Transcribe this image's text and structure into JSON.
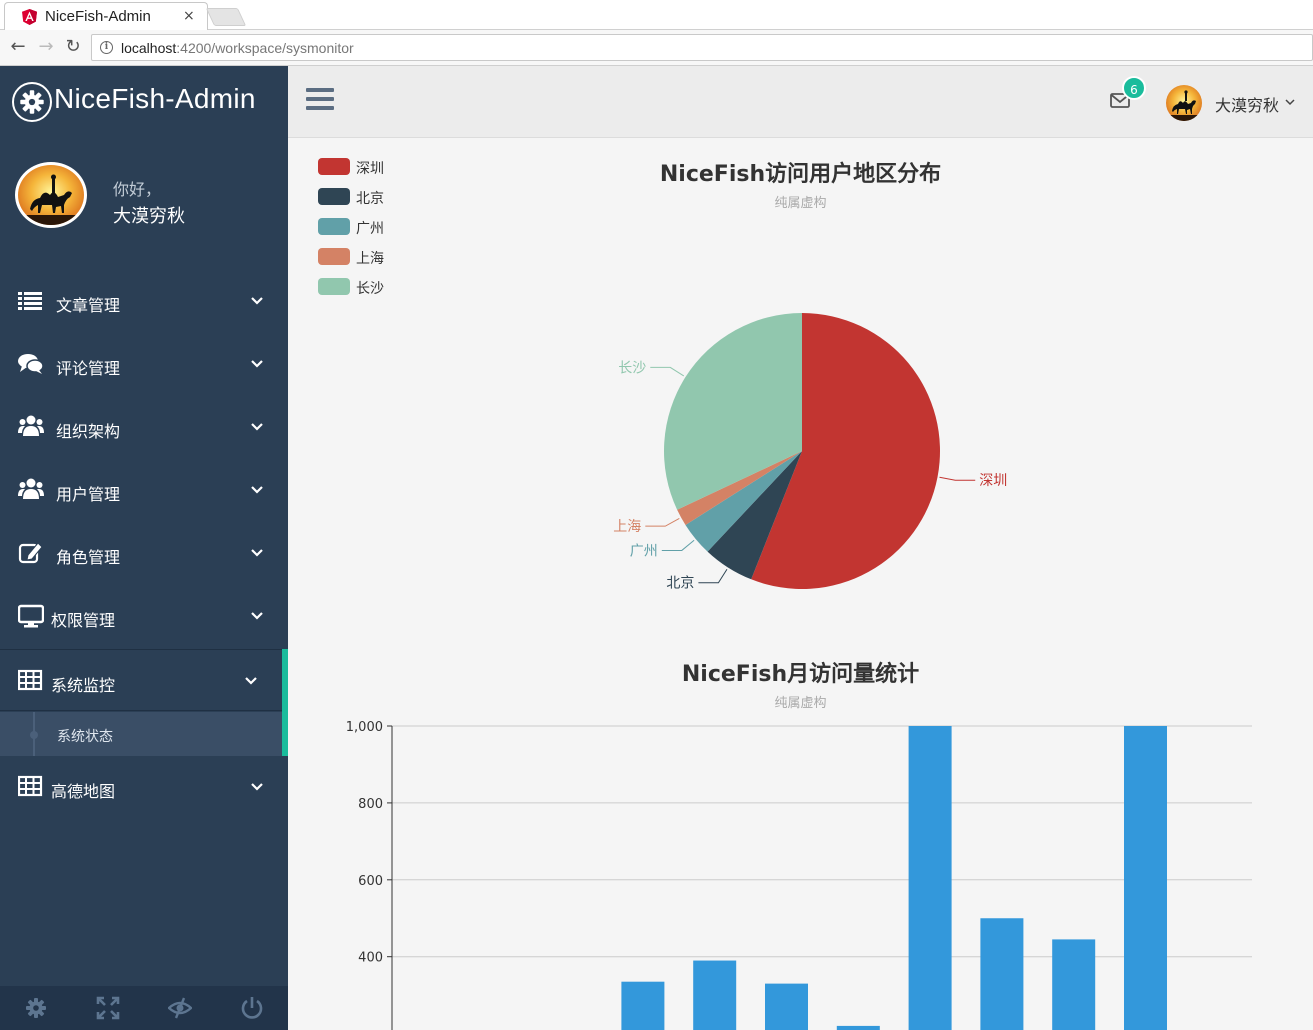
{
  "browser": {
    "tab_title": "NiceFish-Admin",
    "tab_close": "×",
    "url_host": "localhost",
    "url_path": ":4200/workspace/sysmonitor",
    "back": "←",
    "forward": "→",
    "reload": "↻"
  },
  "sidebar": {
    "brand": "NiceFish-Admin",
    "greeting": "你好，",
    "username": "大漠穷秋",
    "items": [
      {
        "label": "文章管理",
        "icon": "list-icon"
      },
      {
        "label": "评论管理",
        "icon": "comments-icon"
      },
      {
        "label": "组织架构",
        "icon": "users-icon"
      },
      {
        "label": "用户管理",
        "icon": "users-icon"
      },
      {
        "label": "角色管理",
        "icon": "edit-icon"
      },
      {
        "label": "权限管理",
        "icon": "monitor-icon"
      },
      {
        "label": "系统监控",
        "icon": "table-icon",
        "active": true
      },
      {
        "label": "高德地图",
        "icon": "table-icon"
      }
    ],
    "submenu_label": "系统状态",
    "footer_icons": [
      "gear-icon",
      "expand-icon",
      "eye-slash-icon",
      "power-icon"
    ]
  },
  "header": {
    "mail_count": "6",
    "user": "大漠穷秋"
  },
  "colors": {
    "sidebar_bg": "#2b3f55",
    "accent": "#1abc9c",
    "bar": "#3398db"
  },
  "chart_data": [
    {
      "type": "pie",
      "title": "NiceFish访问用户地区分布",
      "subtitle": "纯属虚构",
      "legend_position": "top-left",
      "slices": [
        {
          "name": "深圳",
          "value": 56,
          "color": "#c23531"
        },
        {
          "name": "北京",
          "value": 6,
          "color": "#2f4554"
        },
        {
          "name": "广州",
          "value": 4,
          "color": "#61a0a8"
        },
        {
          "name": "上海",
          "value": 2,
          "color": "#d48265"
        },
        {
          "name": "长沙",
          "value": 32,
          "color": "#91c7ae"
        }
      ]
    },
    {
      "type": "bar",
      "title": "NiceFish月访问量统计",
      "subtitle": "纯属虚构",
      "ylim": [
        0,
        1000
      ],
      "y_ticks": [
        400,
        600,
        800,
        1000
      ],
      "y_tick_labels": [
        "400",
        "600",
        "800",
        "1,000"
      ],
      "grid": true,
      "values": [
        0,
        0,
        0,
        335,
        390,
        330,
        220,
        1000,
        500,
        445,
        1000
      ]
    }
  ]
}
